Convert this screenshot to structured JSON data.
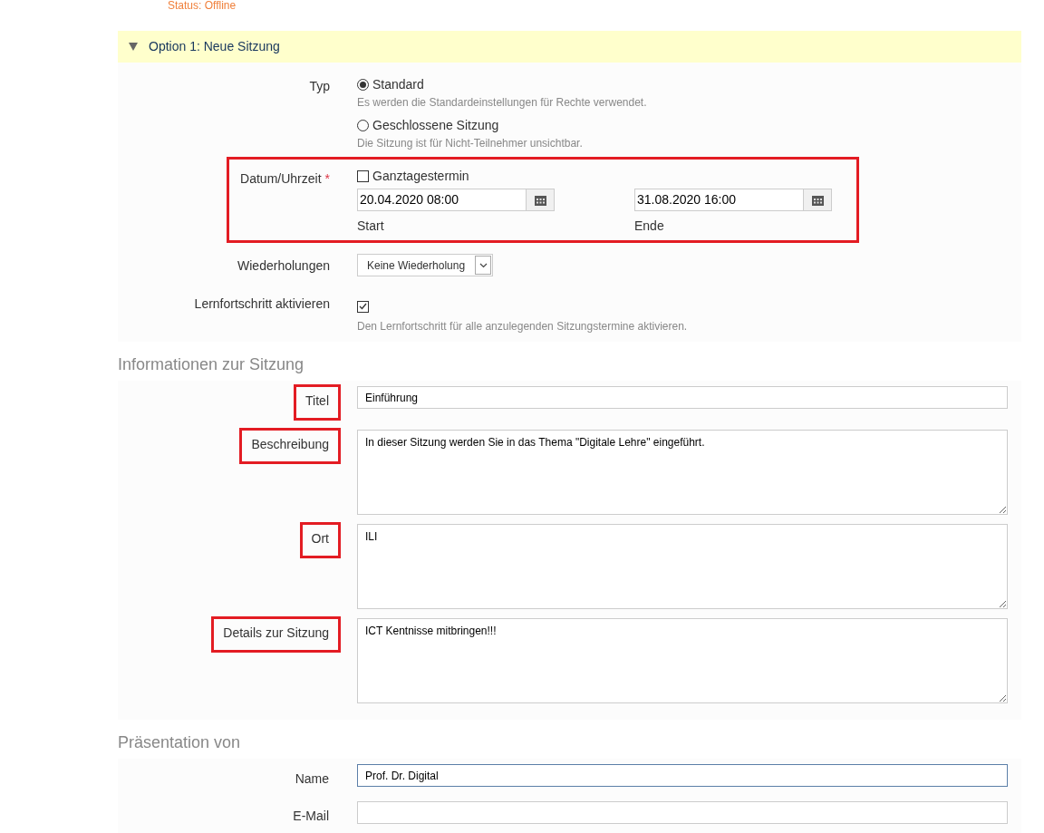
{
  "status": "Status: Offline",
  "option": {
    "title": "Option 1: Neue Sitzung",
    "expanded": true,
    "type": {
      "label": "Typ",
      "options": [
        {
          "label": "Standard",
          "hint": "Es werden die Standardeinstellungen für Rechte verwendet.",
          "selected": true
        },
        {
          "label": "Geschlossene Sitzung",
          "hint": "Die Sitzung ist für Nicht-Teilnehmer unsichtbar.",
          "selected": false
        }
      ]
    },
    "datetime": {
      "label": "Datum/Uhrzeit",
      "required_mark": "*",
      "highlighted": true,
      "all_day": {
        "label": "Ganztagestermin",
        "checked": false
      },
      "start": {
        "value": "20.04.2020 08:00",
        "caption": "Start"
      },
      "end": {
        "value": "31.08.2020 16:00",
        "caption": "Ende"
      }
    },
    "repeat": {
      "label": "Wiederholungen",
      "value": "Keine Wiederholung"
    },
    "progress": {
      "label": "Lernfortschritt aktivieren",
      "checked": true,
      "hint": "Den Lernfortschritt für alle anzulegenden Sitzungstermine aktivieren."
    }
  },
  "sections": [
    {
      "heading": "Informationen zur Sitzung",
      "fields": [
        {
          "label": "Titel",
          "kind": "input",
          "value": "Einführung",
          "focused": false,
          "highlighted": true
        },
        {
          "label": "Beschreibung",
          "kind": "textarea",
          "value": "In dieser Sitzung werden Sie in das Thema \"Digitale Lehre\" eingeführt.",
          "focused": false,
          "highlighted": true
        },
        {
          "label": "Ort",
          "kind": "textarea",
          "value": "ILI",
          "focused": false,
          "highlighted": true
        },
        {
          "label": "Details zur Sitzung",
          "kind": "textarea",
          "value": "ICT Kentnisse mitbringen!!!",
          "focused": false,
          "highlighted": true
        }
      ]
    },
    {
      "heading": "Präsentation von",
      "fields": [
        {
          "label": "Name",
          "kind": "input",
          "value": "Prof. Dr. Digital",
          "focused": true,
          "highlighted": false
        },
        {
          "label": "E-Mail",
          "kind": "input",
          "focused": false,
          "highlighted": false
        }
      ]
    }
  ]
}
